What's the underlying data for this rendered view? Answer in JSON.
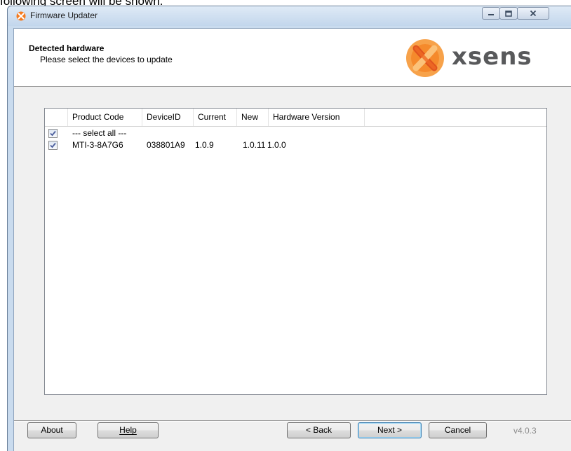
{
  "page_caption": "following screen will be shown.",
  "window": {
    "title": "Firmware Updater",
    "controls": {
      "minimize_icon": "minimize-icon",
      "maximize_icon": "maximize-icon",
      "close_icon": "close-icon"
    }
  },
  "header": {
    "title": "Detected hardware",
    "subtitle": "Please select the devices to update",
    "logo_text": "xsens",
    "brand_color": "#f47b20"
  },
  "device_list": {
    "columns": [
      "Product Code",
      "DeviceID",
      "Current",
      "New",
      "Hardware Version"
    ],
    "rows": [
      {
        "checked": true,
        "product_code": "--- select all ---",
        "device_id": "",
        "current": "",
        "new": "",
        "hardware_version": ""
      },
      {
        "checked": true,
        "product_code": "MTI-3-8A7G6",
        "device_id": "038801A9",
        "current": "1.0.9",
        "new": "1.0.11",
        "hardware_version": "1.0.0"
      }
    ]
  },
  "footer": {
    "about_label": "About",
    "help_label": "Help",
    "back_label": "< Back",
    "next_label": "Next >",
    "cancel_label": "Cancel",
    "version": "v4.0.3"
  }
}
